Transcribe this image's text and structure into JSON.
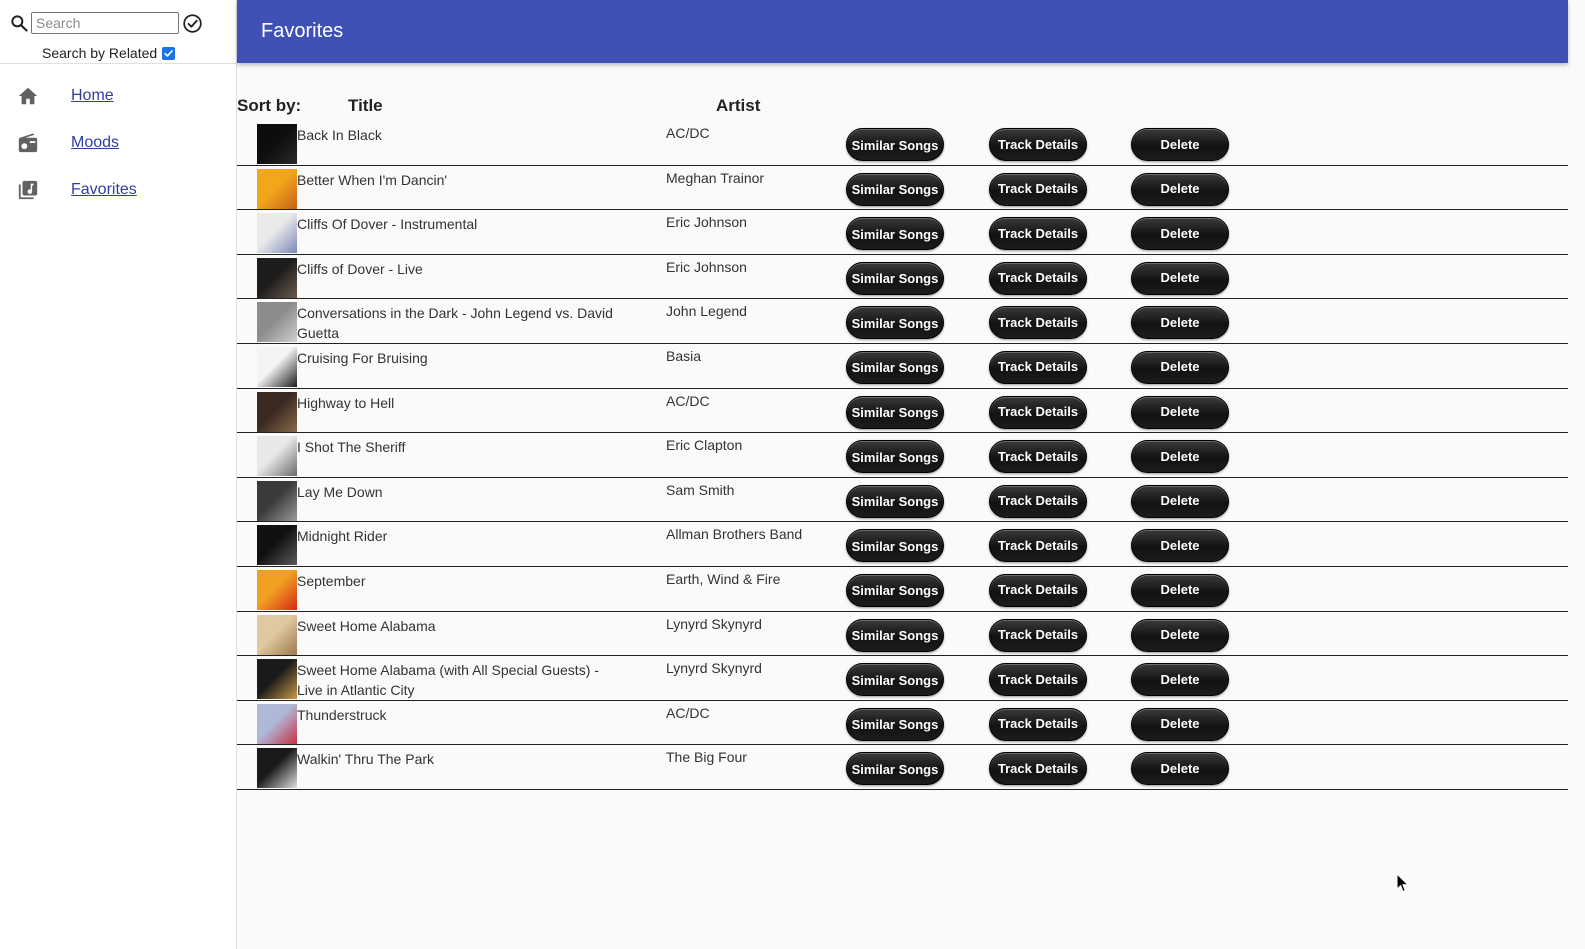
{
  "search": {
    "placeholder": "Search",
    "value": ""
  },
  "related": {
    "label": "Search by Related",
    "checked": true
  },
  "nav": [
    {
      "label": "Home",
      "icon": "home-icon"
    },
    {
      "label": "Moods",
      "icon": "radio-icon"
    },
    {
      "label": "Favorites",
      "icon": "library-music-icon"
    }
  ],
  "header": {
    "title": "Favorites"
  },
  "sort": {
    "label": "Sort by:",
    "title": "Title",
    "artist": "Artist"
  },
  "buttons": {
    "similar": "Similar Songs",
    "details": "Track Details",
    "delete": "Delete"
  },
  "tracks": [
    {
      "title": "Back In Black",
      "artist": "AC/DC",
      "art": [
        "#0d0d0d",
        "#2a2a2a"
      ]
    },
    {
      "title": "Better When I'm Dancin'",
      "artist": "Meghan Trainor",
      "art": [
        "#f2a71b",
        "#c9611a"
      ]
    },
    {
      "title": "Cliffs Of Dover - Instrumental",
      "artist": "Eric Johnson",
      "art": [
        "#eaeaea",
        "#7a86b8"
      ]
    },
    {
      "title": "Cliffs of Dover - Live",
      "artist": "Eric Johnson",
      "art": [
        "#1c1c1c",
        "#6b5a4a"
      ]
    },
    {
      "title": "Conversations in the Dark - John Legend vs. David Guetta",
      "artist": "John Legend",
      "art": [
        "#8c8c8c",
        "#d0d0d0"
      ]
    },
    {
      "title": "Cruising For Bruising",
      "artist": "Basia",
      "art": [
        "#f4f4f4",
        "#1a1a1a"
      ]
    },
    {
      "title": "Highway to Hell",
      "artist": "AC/DC",
      "art": [
        "#3a2a22",
        "#8a6a4a"
      ]
    },
    {
      "title": "I Shot The Sheriff",
      "artist": "Eric Clapton",
      "art": [
        "#e8e8e8",
        "#6a6a6a"
      ]
    },
    {
      "title": "Lay Me Down",
      "artist": "Sam Smith",
      "art": [
        "#3a3a3a",
        "#9a9a9a"
      ]
    },
    {
      "title": "Midnight Rider",
      "artist": "Allman Brothers Band",
      "art": [
        "#111111",
        "#5a5a5a"
      ]
    },
    {
      "title": "September",
      "artist": "Earth, Wind & Fire",
      "art": [
        "#f0a020",
        "#d42a1a"
      ]
    },
    {
      "title": "Sweet Home Alabama",
      "artist": "Lynyrd Skynyrd",
      "art": [
        "#e0c9a0",
        "#a07850"
      ]
    },
    {
      "title": "Sweet Home Alabama (with All Special Guests) - Live in Atlantic City",
      "artist": "Lynyrd Skynyrd",
      "art": [
        "#1a1a1a",
        "#c89a4a"
      ]
    },
    {
      "title": "Thunderstruck",
      "artist": "AC/DC",
      "art": [
        "#b0b8d8",
        "#c83040"
      ]
    },
    {
      "title": "Walkin' Thru The Park",
      "artist": "The Big Four",
      "art": [
        "#1a1a1a",
        "#e0e0e0"
      ]
    }
  ],
  "colors": {
    "header": "#3f51b5",
    "link": "#303f9f",
    "button": "#121212"
  }
}
